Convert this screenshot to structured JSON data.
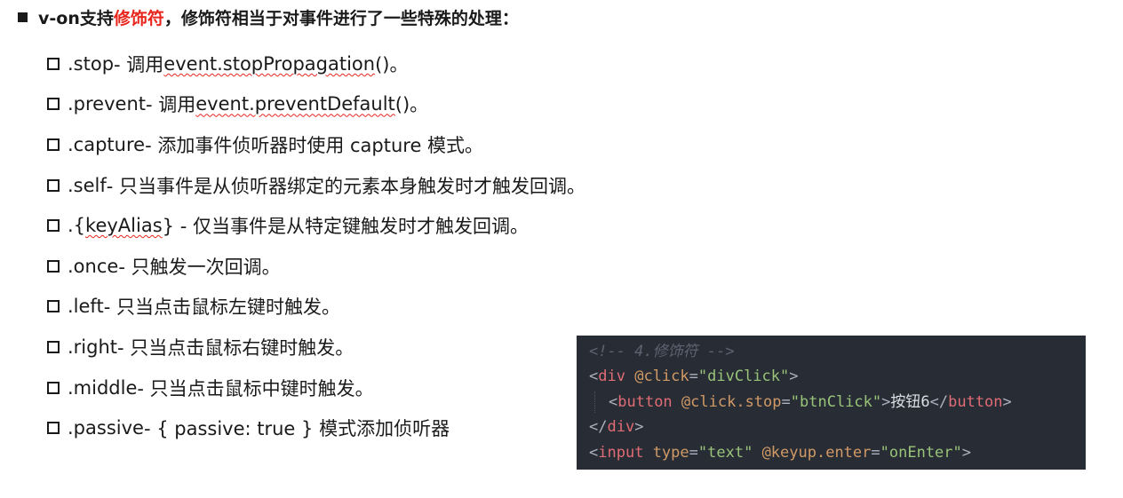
{
  "heading": {
    "prefix": "v-on支持",
    "highlight": "修饰符",
    "suffix": "，修饰符相当于对事件进行了一些特殊的处理："
  },
  "modifiers": [
    {
      "name": ".stop",
      "sep": " - 调用 ",
      "code": "event.stopPropagation",
      "tail": "()。"
    },
    {
      "name": ".prevent",
      "sep": " - 调用 ",
      "code": "event.preventDefault",
      "tail": "()。"
    },
    {
      "name": ".capture",
      "sep": " - 添加事件侦听器时使用 capture 模式。",
      "code": "",
      "tail": ""
    },
    {
      "name": ".self",
      "sep": " - 只当事件是从侦听器绑定的元素本身触发时才触发回调。",
      "code": "",
      "tail": ""
    },
    {
      "name": ".{",
      "sep": "",
      "code": "keyAlias",
      "tail": "} - 仅当事件是从特定键触发时才触发回调。"
    },
    {
      "name": ".once",
      "sep": " - 只触发一次回调。",
      "code": "",
      "tail": ""
    },
    {
      "name": ".left",
      "sep": " - 只当点击鼠标左键时触发。",
      "code": "",
      "tail": ""
    },
    {
      "name": ".right",
      "sep": " - 只当点击鼠标右键时触发。",
      "code": "",
      "tail": ""
    },
    {
      "name": ".middle",
      "sep": " - 只当点击鼠标中键时触发。",
      "code": "",
      "tail": ""
    },
    {
      "name": ".passive",
      "sep": " - { passive: true } 模式添加侦听器",
      "code": "",
      "tail": ""
    }
  ],
  "code": {
    "line1": "<!-- 4.修饰符 -->",
    "line2": {
      "open": "<",
      "tag": "div",
      "attr": "@click",
      "eq": "=",
      "value": "\"divClick\"",
      "close": ">"
    },
    "line3": {
      "open": "<",
      "tag": "button",
      "attr": "@click.stop",
      "eq": "=",
      "value": "\"btnClick\"",
      "gt": ">",
      "text": "按钮6",
      "endopen": "</",
      "endtag": "button",
      "close": ">"
    },
    "line4": {
      "open": "</",
      "tag": "div",
      "close": ">"
    },
    "line5": {
      "open": "<",
      "tag": "input",
      "attr1": "type",
      "eq": "=",
      "value1": "\"text\"",
      "attr2": "@keyup.enter",
      "value2": "\"onEnter\"",
      "close": ">"
    }
  },
  "colors": {
    "highlight": "#e8261d",
    "code_bg": "#282c34"
  }
}
